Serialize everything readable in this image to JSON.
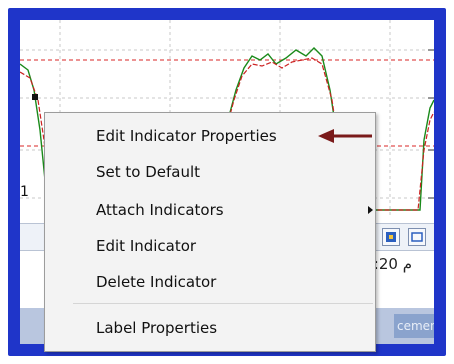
{
  "context_menu": {
    "items": [
      {
        "label": "Edit Indicator Properties"
      },
      {
        "label": "Set to Default"
      },
      {
        "label": "Attach Indicators",
        "has_submenu": true
      },
      {
        "label": "Edit Indicator"
      },
      {
        "label": "Delete Indicator"
      },
      {
        "label": "Label Properties"
      }
    ]
  },
  "chart": {
    "left_axis_labels": [
      "1"
    ],
    "price_line_color": "#1a8a1a",
    "indicator_line_color": "#cc2222",
    "dashed_line_color": "#e05050"
  },
  "status_bar": {
    "time": "9:20 م"
  },
  "bottom_tab": {
    "label": "cement"
  },
  "colors": {
    "frame": "#1f35c9",
    "arrow": "#7a1a1a"
  }
}
